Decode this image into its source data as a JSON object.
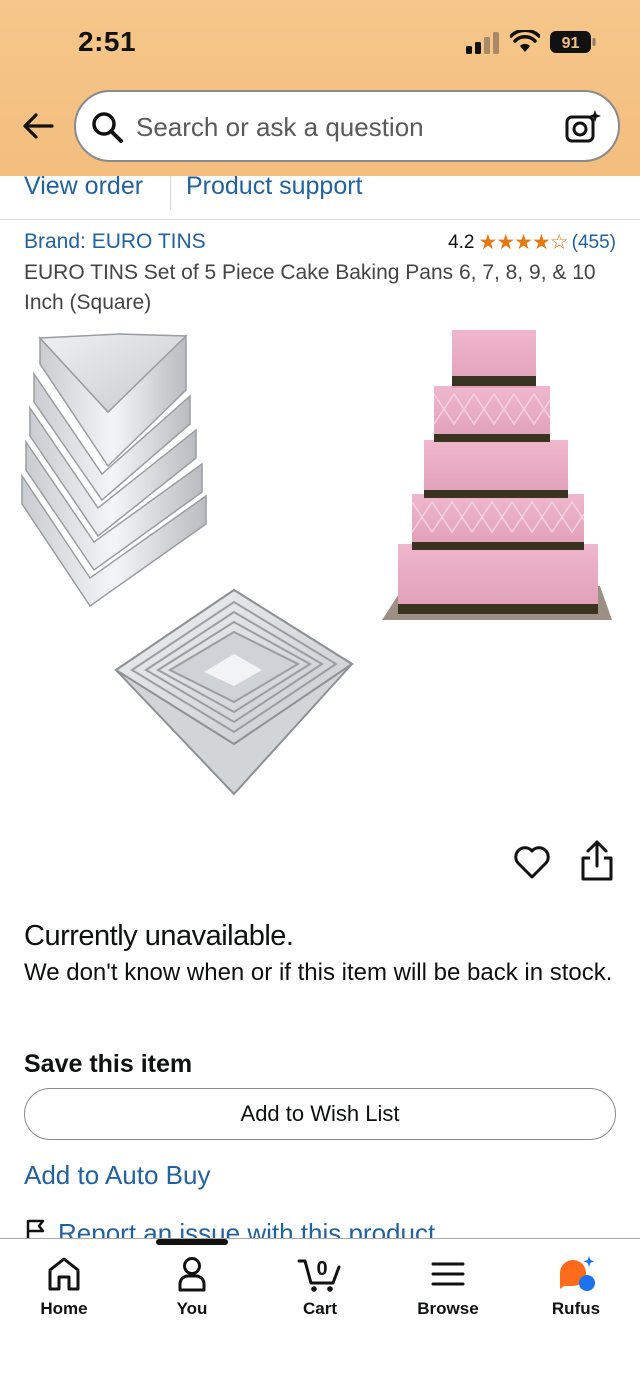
{
  "status_bar": {
    "time": "2:51",
    "battery": "91"
  },
  "search": {
    "placeholder": "Search or ask a question"
  },
  "sublinks": {
    "view_order": "View order",
    "product_support": "Product support"
  },
  "product": {
    "brand": "Brand: EURO TINS",
    "rating": "4.2",
    "stars": "★★★★☆",
    "review_count": "(455)",
    "title": "EURO TINS Set of 5 Piece Cake Baking Pans 6, 7, 8, 9, & 10 Inch (Square)"
  },
  "availability": {
    "status": "Currently unavailable.",
    "message": "We don't know when or if this item will be back in stock."
  },
  "save": {
    "heading": "Save this item",
    "wish_list_button": "Add to Wish List",
    "auto_buy": "Add to Auto Buy",
    "report_issue": "Report an issue with this product"
  },
  "nav": {
    "items": [
      {
        "label": "Home",
        "icon": "home-icon"
      },
      {
        "label": "You",
        "icon": "person-icon"
      },
      {
        "label": "Cart",
        "icon": "cart-icon",
        "badge": "0"
      },
      {
        "label": "Browse",
        "icon": "menu-icon"
      },
      {
        "label": "Rufus",
        "icon": "rufus-icon"
      }
    ]
  },
  "colors": {
    "header_bg": "#f3be7e",
    "link": "#2162a1",
    "star": "#e47911",
    "rufus": "#ff6b1a"
  }
}
